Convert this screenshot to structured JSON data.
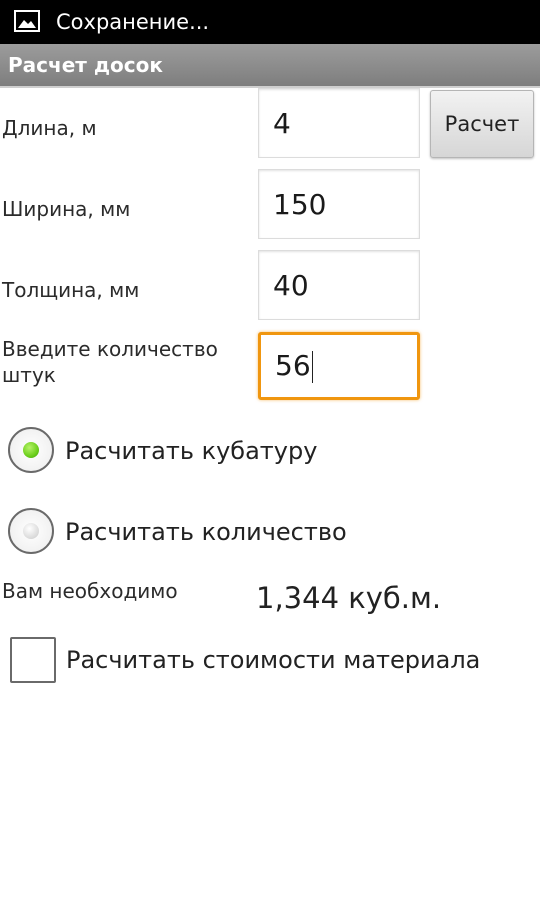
{
  "status_bar": {
    "notification_icon": "image-icon",
    "text": "Сохранение..."
  },
  "app": {
    "title": "Расчет досок"
  },
  "form": {
    "length": {
      "label": "Длина, м",
      "value": "4"
    },
    "width": {
      "label": "Ширина, мм",
      "value": "150"
    },
    "thickness": {
      "label": "Толщина, мм",
      "value": "40"
    },
    "quantity": {
      "label_line1": "Введите количество",
      "label_line2": "штук",
      "value": "56",
      "focused": true
    }
  },
  "calc_button": {
    "label": "Расчет"
  },
  "mode": {
    "options": [
      {
        "label": "Расчитать кубатуру",
        "selected": true
      },
      {
        "label": "Расчитать количество",
        "selected": false
      }
    ]
  },
  "result": {
    "label": "Вам необходимо",
    "value": "1,344 куб.м."
  },
  "cost_option": {
    "label": "Расчитать стоимости материала",
    "checked": false
  },
  "colors": {
    "focus_accent": "#f0960f",
    "radio_selected": "#6ccf1c",
    "title_bar": "#8a8a8a",
    "status_bar": "#000000"
  }
}
